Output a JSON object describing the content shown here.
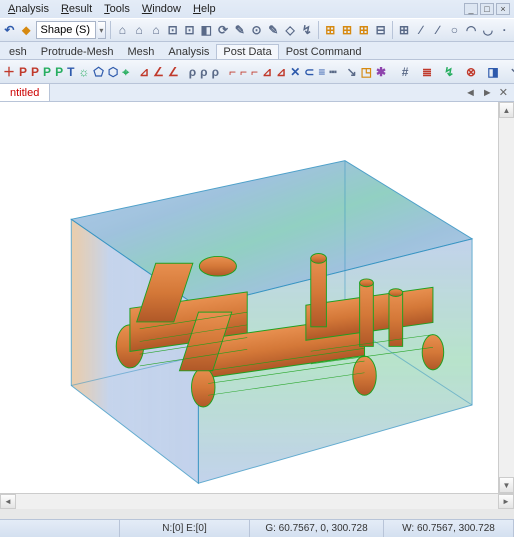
{
  "menu": {
    "items": [
      "Analysis",
      "Result",
      "Tools",
      "Window",
      "Help"
    ]
  },
  "shape": {
    "label": "Shape (S)"
  },
  "tabs": {
    "items": [
      "esh",
      "Protrude-Mesh",
      "Mesh",
      "Analysis",
      "Post Data",
      "Post Command"
    ]
  },
  "title": {
    "text": "ntitled"
  },
  "title_controls": {
    "back": "◄",
    "fwd": "►",
    "close": "✕"
  },
  "status": {
    "left": "N:[0] E:[0]",
    "mid": "G: 60.7567, 0, 300.728",
    "right": "W: 60.7567, 300.728"
  },
  "win": {
    "min": "_",
    "max": "□",
    "close": "×"
  },
  "scroll": {
    "up": "▲",
    "down": "▼",
    "left": "◄",
    "right": "►"
  },
  "icons": {
    "tb1": [
      "↶",
      "⌂",
      "⌂",
      "⌂",
      "⊡",
      "⊡",
      "◧",
      "⟳",
      "✎",
      "⊙",
      "✎",
      "◇",
      "↯",
      "◣",
      "↔",
      "⊞",
      "⊞",
      "⊞",
      "⊟",
      "⊞",
      "∕",
      "∕",
      "○",
      "◠",
      "◡",
      "·"
    ],
    "tb2": [
      "＋",
      "P",
      "P",
      "P",
      "P",
      "T",
      "☼",
      "⬠",
      "⬡",
      "⌖",
      "⊿",
      "∠",
      "∠",
      "ρ",
      "ρ",
      "ρ",
      "⌐",
      "⌐",
      "⌐",
      "⊿",
      "⊿",
      "✕",
      "⊂",
      "≡",
      "┅",
      "↘",
      "◳",
      "✱",
      "#",
      "≣",
      "↯",
      "⊗",
      "◨",
      "↘"
    ]
  }
}
